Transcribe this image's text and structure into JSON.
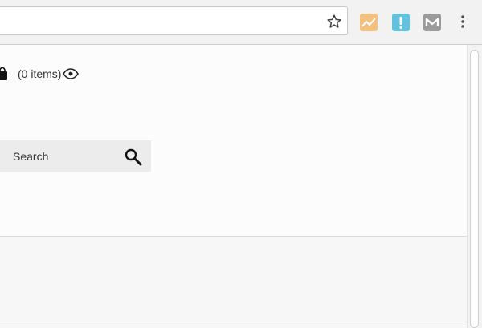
{
  "browser": {
    "bookmark_icon": "star-icon",
    "extensions": [
      {
        "name": "analytics-extension",
        "icon": "trend-chart-icon",
        "color": "#f3c07f"
      },
      {
        "name": "alert-extension",
        "icon": "exclamation-icon",
        "color": "#62c2dd"
      },
      {
        "name": "mail-extension",
        "icon": "m-mail-icon",
        "color": "#9b9b9b"
      }
    ],
    "menu_icon": "vertical-dots-icon"
  },
  "cart": {
    "icon": "shopping-bag-icon",
    "count_text": "(0 items)",
    "view_icon": "eye-icon"
  },
  "search": {
    "placeholder": "Search",
    "icon": "search-icon"
  },
  "colors": {
    "toolbar_bg": "#f2f2f2",
    "content_bg": "#fcfcfc",
    "search_bg": "#ececec",
    "text": "#333333"
  }
}
